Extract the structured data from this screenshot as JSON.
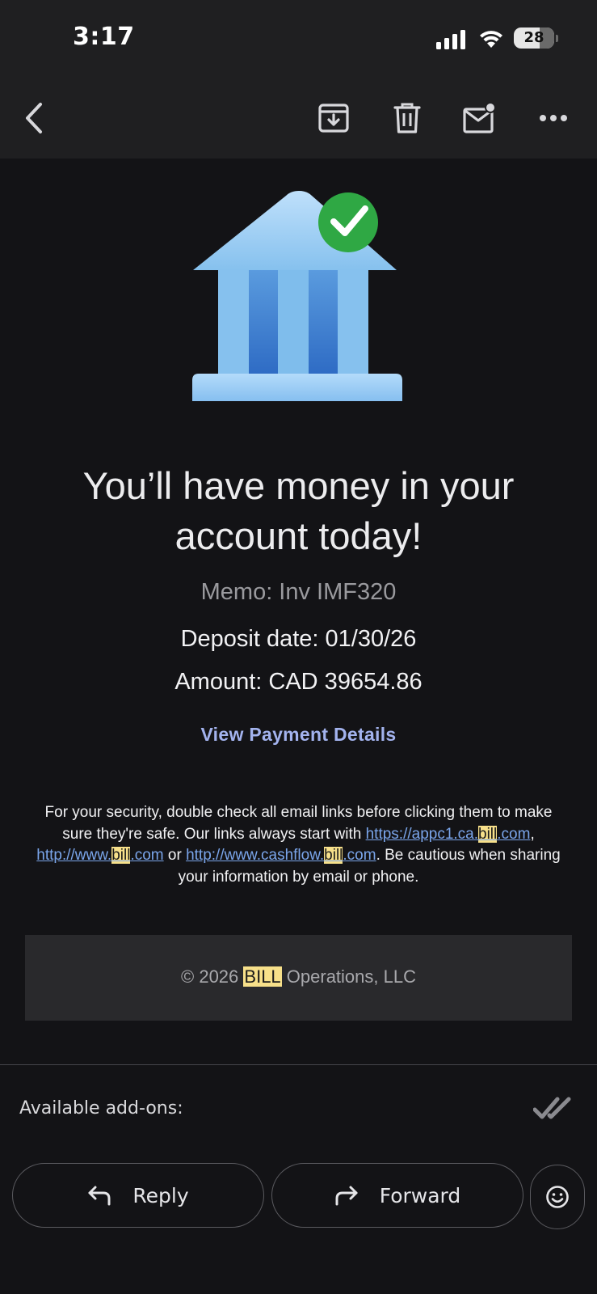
{
  "status_bar": {
    "time": "3:17",
    "battery": "28"
  },
  "email": {
    "headline": "You’ll have money in your account today!",
    "memo": "Memo: Inv IMF320",
    "deposit_date": "Deposit date: 01/30/26",
    "amount": "Amount: CAD 39654.86",
    "cta_label": "View Payment Details",
    "security": {
      "intro": "For your security, double check all email links before clicking them to make sure they're safe. Our links always start with ",
      "link1_pre": "https://appc1.ca.",
      "link1_hl": "bill",
      "link1_post": ".com",
      "sep1": ", ",
      "link2_pre": "http://www.",
      "link2_hl": "bill",
      "link2_post": ".com",
      "sep2": " or ",
      "link3_pre": "http://www.cashflow.",
      "link3_hl": "bill",
      "link3_post": ".com",
      "outro": ". Be cautious when sharing your information by email or phone."
    },
    "footer": {
      "prefix": "© 2026 ",
      "brand": "BILL",
      "suffix": " Operations, LLC"
    }
  },
  "addons_label": "Available add-ons:",
  "actions": {
    "reply": "Reply",
    "forward": "Forward"
  },
  "colors": {
    "accent_link": "#7aa5ea",
    "cta": "#a3b3ee",
    "search_highlight": "#f7e08a",
    "check_green": "#2fa844"
  }
}
